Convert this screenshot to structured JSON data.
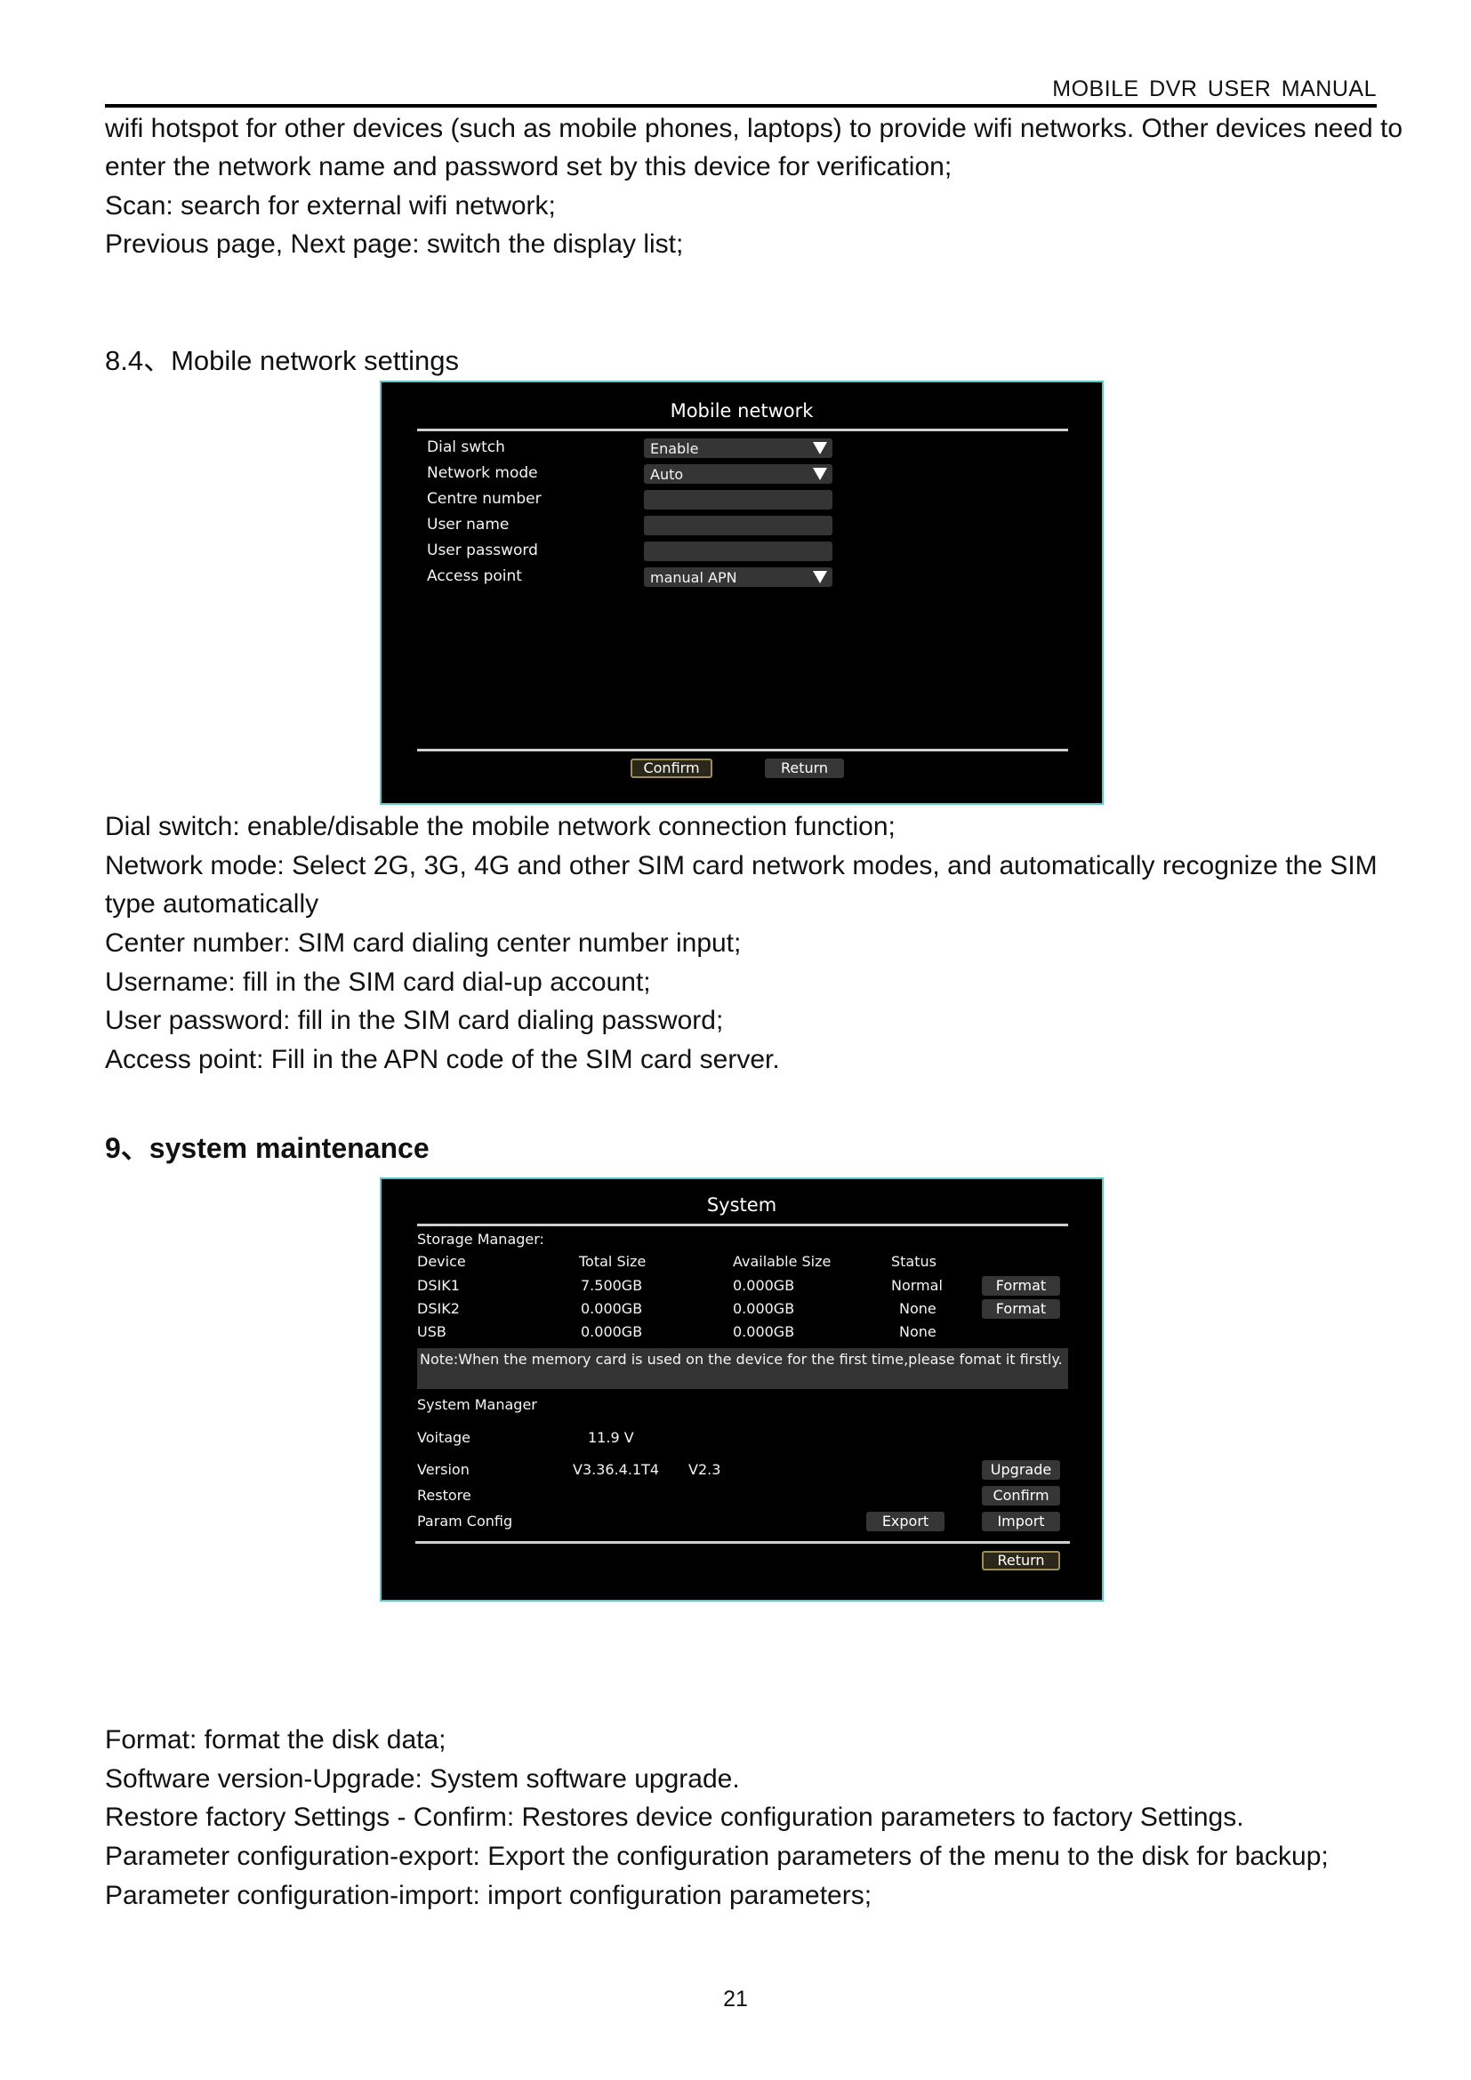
{
  "header": {
    "title": "MOBILE  DVR  USER  MANUAL"
  },
  "intro_lines": [
    "wifi hotspot for other devices (such as mobile phones, laptops) to provide wifi networks. Other devices need to",
    "enter the network name and password set by this device for verification;",
    "Scan: search for external wifi network;",
    "Previous page, Next page: switch the display list;"
  ],
  "section_8_4": {
    "heading": "8.4、Mobile network settings",
    "panel": {
      "title": "Mobile network",
      "rows": [
        {
          "label": "Dial swtch",
          "type": "dropdown",
          "value": "Enable"
        },
        {
          "label": "Network mode",
          "type": "dropdown",
          "value": "Auto"
        },
        {
          "label": "Centre number",
          "type": "text",
          "value": ""
        },
        {
          "label": "User name",
          "type": "text",
          "value": ""
        },
        {
          "label": "User password",
          "type": "text",
          "value": ""
        },
        {
          "label": "Access point",
          "type": "dropdown",
          "value": "manual APN"
        }
      ],
      "confirm_label": "Confirm",
      "return_label": "Return"
    },
    "description_lines": [
      "Dial switch: enable/disable the mobile network connection function;",
      "Network mode: Select 2G, 3G, 4G and other SIM card network modes, and automatically recognize the SIM",
      "type automatically",
      "Center number: SIM card dialing center number input;",
      "Username: fill in the SIM card dial-up account;",
      "User password: fill in the SIM card dialing password;",
      "Access point: Fill in the APN code of the SIM card server."
    ]
  },
  "section_9": {
    "heading": "9、system maintenance",
    "panel": {
      "title": "System",
      "storage_title": "Storage Manager:",
      "columns": [
        "Device",
        "Total Size",
        "Available Size",
        "Status"
      ],
      "rows": [
        {
          "device": "DSIK1",
          "total": "7.500GB",
          "available": "0.000GB",
          "status": "Normal",
          "action": "Format"
        },
        {
          "device": "DSIK2",
          "total": "0.000GB",
          "available": "0.000GB",
          "status": "None",
          "action": "Format"
        },
        {
          "device": "USB",
          "total": "0.000GB",
          "available": "0.000GB",
          "status": "None",
          "action": ""
        }
      ],
      "note": "Note:When the memory card is used on the device for the first time,please fomat it firstly.",
      "system_title": "System Manager",
      "voltage_label": "Voitage",
      "voltage_value": "11.9 V",
      "version_label": "Version",
      "version_value_1": "V3.36.4.1T4",
      "version_value_2": "V2.3",
      "upgrade_label": "Upgrade",
      "restore_label": "Restore",
      "restore_button": "Confirm",
      "param_label": "Param Config",
      "export_label": "Export",
      "import_label": "Import",
      "return_label": "Return"
    },
    "description_lines": [
      "Format: format the disk data;",
      "Software version-Upgrade: System software upgrade.",
      "Restore factory Settings - Confirm: Restores device configuration parameters to factory Settings.",
      "Parameter configuration-export: Export the configuration parameters of the menu to the disk for backup;",
      "Parameter configuration-import: import configuration parameters;"
    ]
  },
  "footer": {
    "page_number": "21"
  }
}
